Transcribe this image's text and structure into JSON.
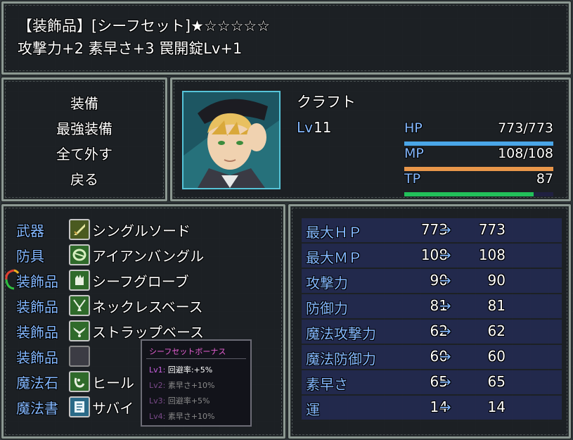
{
  "help": {
    "line1": "【装飾品】[シーフセット]★☆☆☆☆☆",
    "line2": "攻撃力+2 素早さ+3 罠開錠Lv+1"
  },
  "commands": [
    "装備",
    "最強装備",
    "全て外す",
    "戻る"
  ],
  "actor": {
    "name": "クラフト",
    "level_label": "Lv",
    "level": "11",
    "hp": {
      "label": "HP",
      "value": "773/773",
      "ratio": 1.0,
      "color": "#4aa6e8"
    },
    "mp": {
      "label": "MP",
      "value": "108/108",
      "ratio": 1.0,
      "color": "#e8964a"
    },
    "tp": {
      "label": "TP",
      "value": "87",
      "ratio": 0.87,
      "color": "#22c05a"
    }
  },
  "slots": [
    {
      "type": "武器",
      "icon": "sword-icon",
      "name": "シングルソード"
    },
    {
      "type": "防具",
      "icon": "bangle-icon",
      "name": "アイアンバングル"
    },
    {
      "type": "装飾品",
      "icon": "glove-icon",
      "name": "シーフグローブ"
    },
    {
      "type": "装飾品",
      "icon": "necklace-icon",
      "name": "ネックレスベース"
    },
    {
      "type": "装飾品",
      "icon": "strap-icon",
      "name": "ストラップベース"
    },
    {
      "type": "装飾品",
      "icon": "empty-slot-icon",
      "name": ""
    },
    {
      "type": "魔法石",
      "icon": "magic-stone-icon",
      "name": "ヒール"
    },
    {
      "type": "魔法書",
      "icon": "magic-book-icon",
      "name": "サバイ"
    }
  ],
  "tooltip": {
    "title": "シーフセットボーナス",
    "rows": [
      {
        "lv": "Lv1:",
        "text": "回避率:+5%",
        "active": true
      },
      {
        "lv": "Lv2:",
        "text": "素早さ+10%",
        "active": false
      },
      {
        "lv": "Lv3:",
        "text": "回避率+5%",
        "active": false
      },
      {
        "lv": "Lv4:",
        "text": "素早さ+10%",
        "active": false
      }
    ]
  },
  "params": [
    {
      "name": "最大ＨＰ",
      "current": "773",
      "arrow": "→",
      "new": "773"
    },
    {
      "name": "最大ＭＰ",
      "current": "108",
      "arrow": "→",
      "new": "108"
    },
    {
      "name": "攻撃力",
      "current": "90",
      "arrow": "→",
      "new": "90"
    },
    {
      "name": "防御力",
      "current": "81",
      "arrow": "→",
      "new": "81"
    },
    {
      "name": "魔法攻撃力",
      "current": "62",
      "arrow": "→",
      "new": "62"
    },
    {
      "name": "魔法防御力",
      "current": "60",
      "arrow": "→",
      "new": "60"
    },
    {
      "name": "素早さ",
      "current": "65",
      "arrow": "→",
      "new": "65"
    },
    {
      "name": "運",
      "current": "14",
      "arrow": "→",
      "new": "14"
    }
  ]
}
